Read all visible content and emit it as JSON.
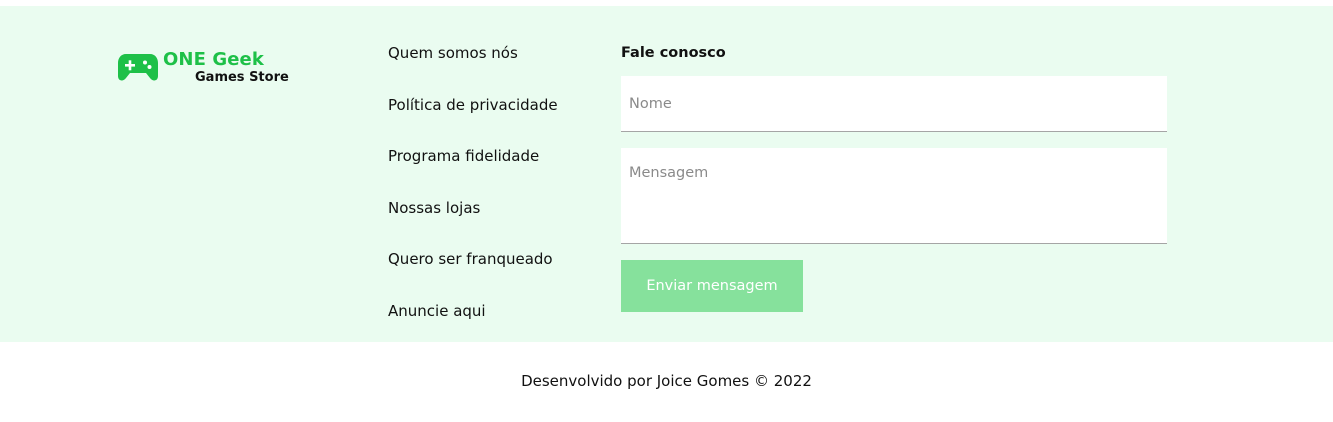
{
  "brand": {
    "name": "ONE Geek",
    "subtitle": "Games Store",
    "icon": "game-controller-icon",
    "color": "#1ec048"
  },
  "links": [
    "Quem somos nós",
    "Política de privacidade",
    "Programa fidelidade",
    "Nossas lojas",
    "Quero ser franqueado",
    "Anuncie aqui"
  ],
  "contact": {
    "title": "Fale conosco",
    "name_placeholder": "Nome",
    "message_placeholder": "Mensagem",
    "submit_label": "Enviar mensagem",
    "button_color": "#86e19c"
  },
  "credits": "Desenvolvido por Joice Gomes © 2022",
  "colors": {
    "footer_background": "#eafcf0"
  }
}
